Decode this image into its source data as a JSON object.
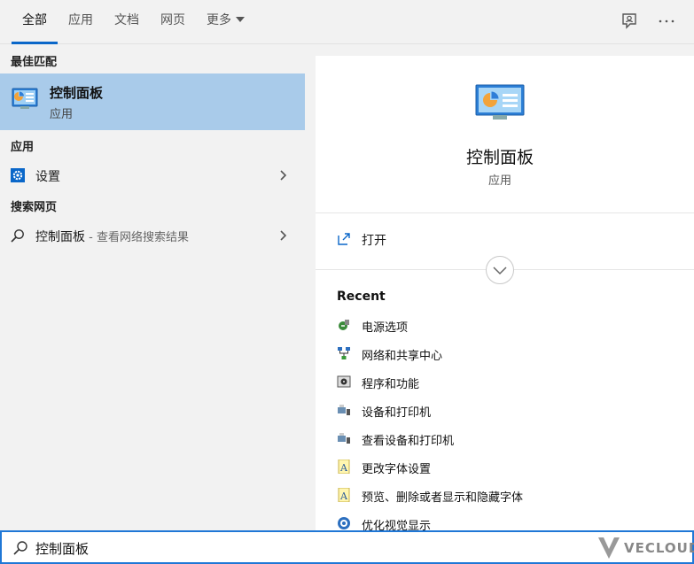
{
  "tabs": [
    {
      "label": "全部",
      "active": true
    },
    {
      "label": "应用"
    },
    {
      "label": "文档"
    },
    {
      "label": "网页"
    },
    {
      "label": "更多"
    }
  ],
  "top_icons": [
    "feedback-icon",
    "more-options-icon"
  ],
  "left": {
    "best_match_title": "最佳匹配",
    "best_match": {
      "name": "控制面板",
      "type": "应用",
      "icon": "control-panel-icon"
    },
    "apps_title": "应用",
    "apps": [
      {
        "label": "设置",
        "icon": "gear-icon"
      }
    ],
    "web_title": "搜索网页",
    "web": [
      {
        "label": "控制面板",
        "hint": " - 查看网络搜索结果",
        "icon": "search-icon"
      }
    ]
  },
  "right": {
    "title": "控制面板",
    "subtitle": "应用",
    "open_label": "打开",
    "recent_title": "Recent",
    "recent": [
      {
        "label": "电源选项",
        "icon": "power-options-icon"
      },
      {
        "label": "网络和共享中心",
        "icon": "network-icon"
      },
      {
        "label": "程序和功能",
        "icon": "programs-icon"
      },
      {
        "label": "设备和打印机",
        "icon": "printer-icon"
      },
      {
        "label": "查看设备和打印机",
        "icon": "printer-icon"
      },
      {
        "label": "更改字体设置",
        "icon": "font-icon"
      },
      {
        "label": "预览、删除或者显示和隐藏字体",
        "icon": "font-icon"
      },
      {
        "label": "优化视觉显示",
        "icon": "ease-of-access-icon"
      }
    ]
  },
  "search": {
    "query": "控制面板"
  },
  "watermark": {
    "text": "VECLOUD"
  },
  "colors": {
    "accent": "#0a67c9",
    "selection": "#a9cbea",
    "border": "#1f77d6"
  }
}
